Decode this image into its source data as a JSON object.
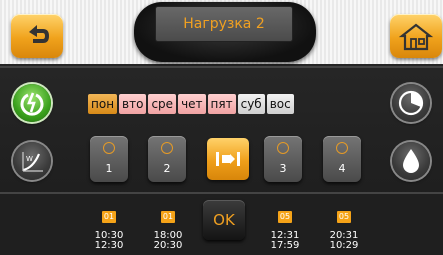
{
  "header": {
    "title": "Нагрузка 2"
  },
  "days": [
    {
      "label": "пон",
      "state": "selected"
    },
    {
      "label": "вто",
      "state": "active"
    },
    {
      "label": "сре",
      "state": "active"
    },
    {
      "label": "чет",
      "state": "active"
    },
    {
      "label": "пят",
      "state": "active"
    },
    {
      "label": "суб",
      "state": "inactive"
    },
    {
      "label": "вос",
      "state": "inactive"
    }
  ],
  "slots": [
    {
      "number": "1"
    },
    {
      "number": "2"
    },
    {
      "number": "3"
    },
    {
      "number": "4"
    }
  ],
  "time_entries": [
    {
      "badge": "01",
      "start": "10:30",
      "end": "12:30"
    },
    {
      "badge": "01",
      "start": "18:00",
      "end": "20:30"
    },
    {
      "badge": "05",
      "start": "12:31",
      "end": "17:59"
    },
    {
      "badge": "05",
      "start": "20:31",
      "end": "10:29"
    }
  ],
  "ok_label": "OK",
  "icons": {
    "back": "back-arrow-icon",
    "home": "home-icon",
    "power": "power-icon",
    "curve": "heating-curve-icon",
    "gauge": "pie-gauge-icon",
    "drop": "water-drop-icon",
    "edit": "edit-slot-icon"
  },
  "colors": {
    "accent": "#f0a021",
    "day_selected": "#e09a2a",
    "day_active": "#f3a8a8",
    "day_inactive": "#dcdcdc",
    "power_green": "#3aa11d"
  }
}
